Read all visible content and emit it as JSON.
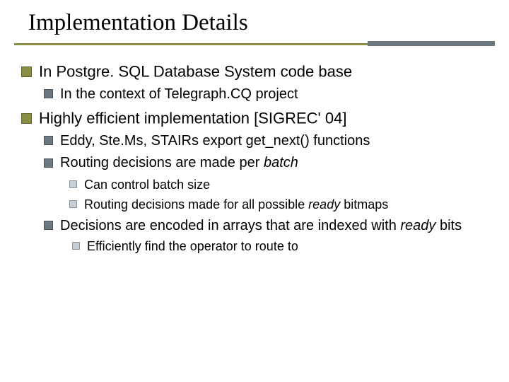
{
  "title": "Implementation Details",
  "b1": {
    "a": "In Postgre. SQL Database System code base",
    "a1": "In the context of Telegraph.CQ project",
    "b": "Highly efficient implementation [SIGREC' 04]",
    "b1": "Eddy, Ste.Ms, STAIRs export get_next() functions",
    "b2_pre": "Routing decisions are made per ",
    "b2_em": "batch",
    "b2a": "Can control batch size",
    "b2b_pre": "Routing decisions made for all possible ",
    "b2b_em": "ready",
    "b2b_post": " bitmaps",
    "b3_pre": "Decisions are encoded in arrays that are indexed with ",
    "b3_em": "ready",
    "b3_post": " bits",
    "b3a": "Efficiently find the operator to route to"
  }
}
